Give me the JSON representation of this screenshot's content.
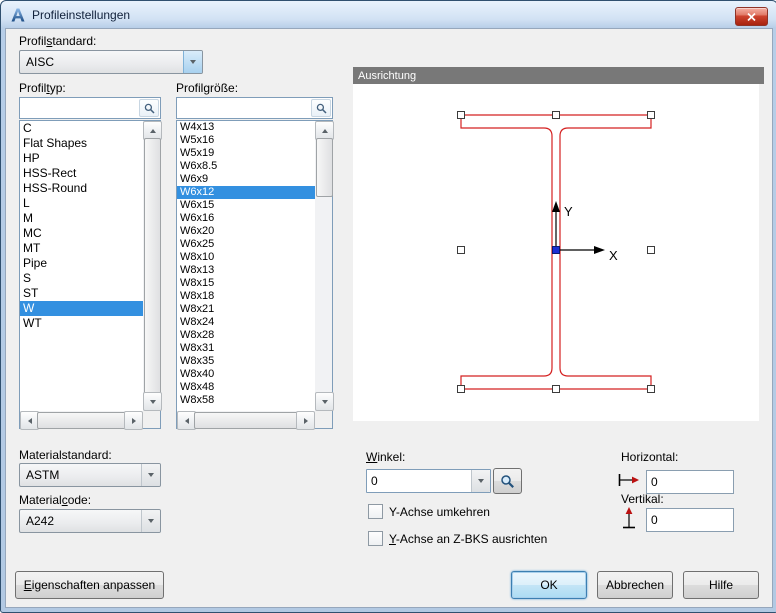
{
  "window": {
    "title": "Profileinstellungen"
  },
  "profilstandard": {
    "label": "Profil[s]tandard:",
    "value": "AISC"
  },
  "profiltyp": {
    "label": "Profil[t]yp:",
    "search": "",
    "selected": "W",
    "items": [
      "C",
      "Flat Shapes",
      "HP",
      "HSS-Rect",
      "HSS-Round",
      "L",
      "M",
      "MC",
      "MT",
      "Pipe",
      "S",
      "ST",
      "W",
      "WT"
    ]
  },
  "profilgroesse": {
    "label": "Profil[g]röße:",
    "search": "",
    "selected": "W6x12",
    "items": [
      "W4x13",
      "W5x16",
      "W5x19",
      "W6x8.5",
      "W6x9",
      "W6x12",
      "W6x15",
      "W6x16",
      "W6x20",
      "W6x25",
      "W8x10",
      "W8x13",
      "W8x15",
      "W8x18",
      "W8x21",
      "W8x24",
      "W8x28",
      "W8x31",
      "W8x35",
      "W8x40",
      "W8x48",
      "W8x58"
    ]
  },
  "materialstandard": {
    "label": "Materialstandard:",
    "value": "ASTM"
  },
  "materialcode": {
    "label": "Material[c]ode:",
    "value": "A242"
  },
  "ausrichtung": {
    "header": "Ausrichtung",
    "axis_x": "X",
    "axis_y": "Y"
  },
  "winkel": {
    "label": "[W]inkel:",
    "value": "0"
  },
  "checkboxes": {
    "flip_y": {
      "label": "Y-Achse umkehren",
      "checked": false
    },
    "align_y": {
      "label": "[Y]-Achse an Z-BKS ausrichten",
      "checked": false
    }
  },
  "offsets": {
    "horizontal": {
      "label": "Horizontal:",
      "value": "0"
    },
    "vertikal": {
      "label": "Vertikal:",
      "value": "0"
    }
  },
  "buttons": {
    "properties": "[E]igenschaften anpassen",
    "ok": "OK",
    "cancel": "Abbrechen",
    "help": "Hilfe"
  },
  "colors": {
    "selection": "#3390e0",
    "profile_outline": "#d42020",
    "panel_header": "#787878"
  }
}
